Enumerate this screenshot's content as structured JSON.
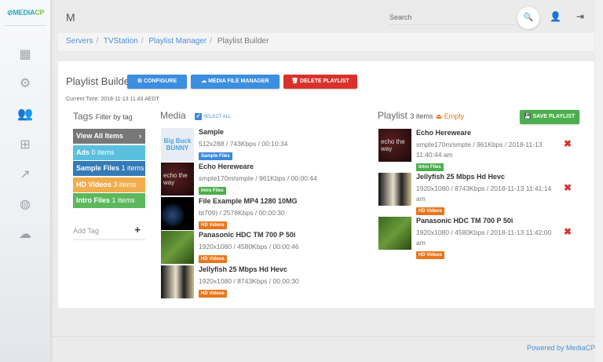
{
  "brand": {
    "logo_a": "MEDIA",
    "logo_b": "CP"
  },
  "sidebar": {
    "items": [
      {
        "icon": "dashboard-icon"
      },
      {
        "icon": "gears-icon"
      },
      {
        "icon": "users-icon"
      },
      {
        "icon": "sitemap-icon"
      },
      {
        "icon": "chart-line-icon"
      },
      {
        "icon": "globe-icon"
      },
      {
        "icon": "cloud-download-icon"
      }
    ]
  },
  "header": {
    "title": "M",
    "search_placeholder": "Search"
  },
  "breadcrumb": [
    "Servers",
    "TVStation",
    "Playlist Manager",
    "Playlist Builder"
  ],
  "page": {
    "title": "Playlist Builder",
    "configure": "CONFIGURE",
    "media_manager": "MEDIA FILE MANAGER",
    "delete": "DELETE PLAYLIST",
    "current_time": "Current Time: 2018-11-13 11:43 AEDT"
  },
  "tags": {
    "heading": "Tags",
    "sub": "Filter by tag",
    "items": [
      {
        "name": "View All Items",
        "count": "",
        "color": "#777777"
      },
      {
        "name": "Ads",
        "count": "0 items",
        "color": "#5bc0de"
      },
      {
        "name": "Sample Files",
        "count": "1 items",
        "color": "#337ab7"
      },
      {
        "name": "HD Videos",
        "count": "3 items",
        "color": "#f0ad4e"
      },
      {
        "name": "Intro Files",
        "count": "1 items",
        "color": "#5cb85c"
      }
    ],
    "add_placeholder": "Add Tag"
  },
  "media": {
    "heading": "Media",
    "select_all": "SELECT ALL",
    "items": [
      {
        "name": "Sample",
        "meta": "512x288 / 743Kbps / 00:10:34",
        "tag": "Sample Files",
        "tag_color": "#3b8ad9",
        "thumb_text": "Big Buck BUNNY"
      },
      {
        "name": "Echo Hereweare",
        "meta": "smpte170m/smpte / 961Kbps / 00:00:44",
        "tag": "Intro Files",
        "tag_color": "#4cae4c",
        "thumb_text": "echo the way"
      },
      {
        "name": "File Example MP4 1280 10MG",
        "meta": "bt709) / 2578Kbps / 00:00:30",
        "tag": "HD Videos",
        "tag_color": "#e8761c"
      },
      {
        "name": "Panasonic HDC TM 700 P 50i",
        "meta": "1920x1080 / 4580Kbps / 00:00:46",
        "tag": "HD Videos",
        "tag_color": "#e8761c"
      },
      {
        "name": "Jellyfish 25 Mbps Hd Hevc",
        "meta": "1920x1080 / 8743Kbps / 00:00:30",
        "tag": "HD Videos",
        "tag_color": "#e8761c"
      }
    ]
  },
  "playlist": {
    "heading": "Playlist",
    "count": "3 items",
    "empty": "Empty",
    "save": "SAVE PLAYLIST",
    "items": [
      {
        "name": "Echo Hereweare",
        "meta": "smpte170m/smpte / 961Kbps / 2018-11-13 11:40:44 am",
        "tag": "Intro Files",
        "tag_color": "#4cae4c",
        "thumb_text": "echo the way"
      },
      {
        "name": "Jellyfish 25 Mbps Hd Hevc",
        "meta": "1920x1080 / 8743Kbps / 2018-11-13 11:41:14 am",
        "tag": "HD Videos",
        "tag_color": "#e8761c"
      },
      {
        "name": "Panasonic HDC TM 700 P 50i",
        "meta": "1920x1080 / 4580Kbps / 2018-11-13 11:42:00 am",
        "tag": "HD Videos",
        "tag_color": "#e8761c"
      }
    ]
  },
  "footer": "Powered by MediaCP"
}
